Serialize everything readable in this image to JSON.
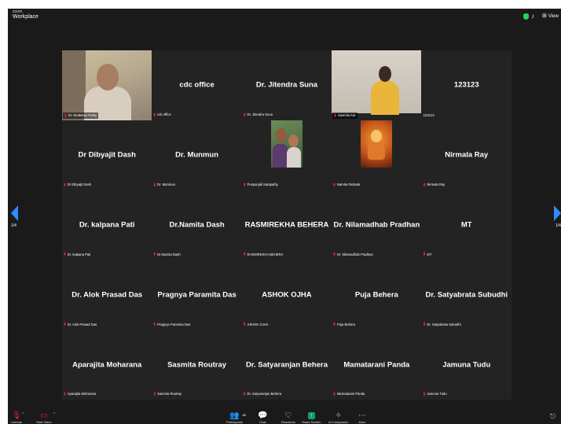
{
  "app": {
    "title_line1": "zoom",
    "title_line2": "Workplace",
    "view_label": "View"
  },
  "pagination": {
    "left": "1/4",
    "right": "1/4"
  },
  "tiles": [
    {
      "big": "",
      "label": "Dr. Niraketan Pathy"
    },
    {
      "big": "cdc office",
      "label": "cdc office"
    },
    {
      "big": "Dr. Jitendra Suna",
      "label": "Dr. Jitendra Suna"
    },
    {
      "big": "",
      "label": "Sasmita Kar"
    },
    {
      "big": "123123",
      "label": "123123"
    },
    {
      "big": "Dr Dibyajit Dash",
      "label": "Dr Dibyajit Dash"
    },
    {
      "big": "Dr. Munmun",
      "label": "Dr. Munmun"
    },
    {
      "big": "",
      "label": "Puspanjali Satapathy"
    },
    {
      "big": "",
      "label": "Namita Pattnaik"
    },
    {
      "big": "Nirmala Ray",
      "label": "Nirmala Ray"
    },
    {
      "big": "Dr. kalpana Pati",
      "label": "Dr. kalpana Pati"
    },
    {
      "big": "Dr.Namita Dash",
      "label": "Dr.Namita Dash"
    },
    {
      "big": "RASMIREKHA BEHERA",
      "label": "RASMIREKHA BEHERA"
    },
    {
      "big": "Dr. Nilamadhab Pradhan",
      "label": "Dr. Nilamadhab Pradhan"
    },
    {
      "big": "MT",
      "label": "MT"
    },
    {
      "big": "Dr. Alok Prasad Das",
      "label": "Dr. Alok Prasad Das"
    },
    {
      "big": "Pragnya Paramita Das",
      "label": "Pragnya Paramita Das"
    },
    {
      "big": "ASHOK OJHA",
      "label": "ASHOK OJHA"
    },
    {
      "big": "Puja Behera",
      "label": "Puja Behera"
    },
    {
      "big": "Dr. Satyabrata Subudhi",
      "label": "Dr. Satyabrata Subudhi"
    },
    {
      "big": "Aparajita Moharana",
      "label": "Aparajita Moharana"
    },
    {
      "big": "Sasmita Routray",
      "label": "Sasmita Routray"
    },
    {
      "big": "Dr. Satyaranjan Behera",
      "label": "Dr. Satyaranjan Behera"
    },
    {
      "big": "Mamatarani Panda",
      "label": "Mamatarani Panda"
    },
    {
      "big": "Jamuna Tudu",
      "label": "Jamuna Tudu"
    }
  ],
  "toolbar": {
    "unmute": "Unmute",
    "start_video": "Start Video",
    "participants": "Participants",
    "participants_count": "85",
    "chat": "Chat",
    "reactions": "Reactions",
    "share_screen": "Share Screen",
    "ai_companion": "AI Companion",
    "more": "More"
  },
  "colors": {
    "accent": "#2d8cff",
    "muted": "#e02828",
    "share": "#0e9f6e",
    "active_border": "#c9d66e",
    "background": "#1a1a1a"
  }
}
